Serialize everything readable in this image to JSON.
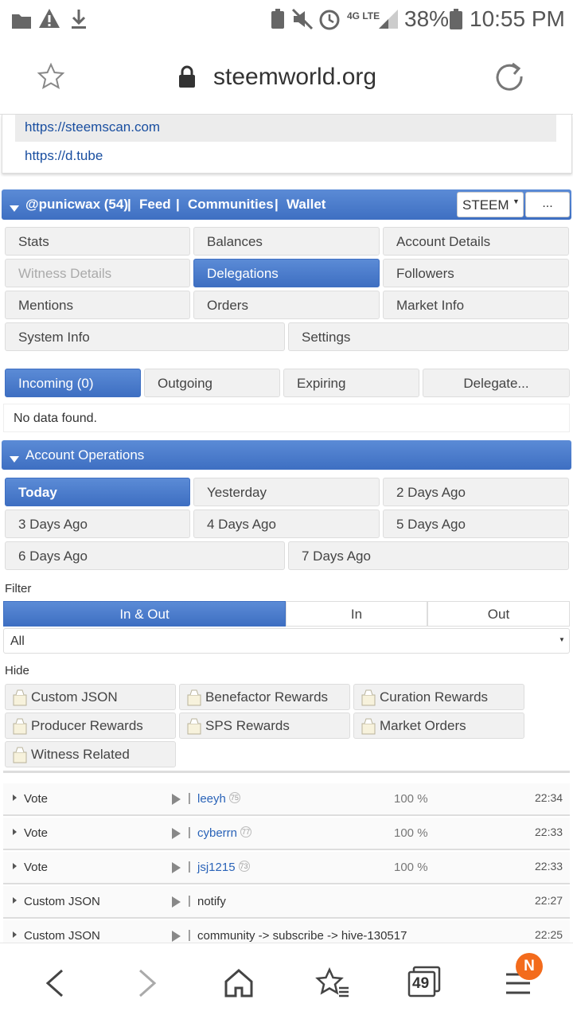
{
  "status_bar": {
    "battery": "38%",
    "time": "10:55 PM",
    "network": "4G LTE"
  },
  "browser": {
    "url": "steemworld.org",
    "tab_count": "49",
    "menu_badge": "N"
  },
  "links": [
    "https://steemscan.com",
    "https://d.tube"
  ],
  "account_bar": {
    "account": "@punicwax (54)",
    "sep": "|",
    "feed": "Feed",
    "communities": "Communities",
    "wallet": "Wallet",
    "currency": "STEEM",
    "more": "..."
  },
  "tabs": {
    "stats": "Stats",
    "balances": "Balances",
    "account_details": "Account Details",
    "witness_details": "Witness Details",
    "delegations": "Delegations",
    "followers": "Followers",
    "mentions": "Mentions",
    "orders": "Orders",
    "market_info": "Market Info",
    "system_info": "System Info",
    "settings": "Settings"
  },
  "delegation_tabs": {
    "incoming": "Incoming (0)",
    "outgoing": "Outgoing",
    "expiring": "Expiring",
    "delegate": "Delegate..."
  },
  "no_data": "No data found.",
  "account_operations": {
    "title": "Account Operations",
    "days": {
      "today": "Today",
      "yesterday": "Yesterday",
      "d2": "2 Days Ago",
      "d3": "3 Days Ago",
      "d4": "4 Days Ago",
      "d5": "5 Days Ago",
      "d6": "6 Days Ago",
      "d7": "7 Days Ago"
    },
    "filter_label": "Filter",
    "filter": {
      "in_out": "In & Out",
      "in": "In",
      "out": "Out"
    },
    "select_value": "All",
    "hide_label": "Hide",
    "hide": {
      "custom_json": "Custom JSON",
      "benefactor": "Benefactor Rewards",
      "curation": "Curation Rewards",
      "producer": "Producer Rewards",
      "sps": "SPS Rewards",
      "market": "Market Orders",
      "witness": "Witness Related"
    },
    "rows": [
      {
        "type": "Vote",
        "who": "leeyh",
        "rep": "75",
        "pct": "100 %",
        "time": "22:34"
      },
      {
        "type": "Vote",
        "who": "cyberrn",
        "rep": "77",
        "pct": "100 %",
        "time": "22:33"
      },
      {
        "type": "Vote",
        "who": "jsj1215",
        "rep": "73",
        "pct": "100 %",
        "time": "22:33"
      },
      {
        "type": "Custom JSON",
        "who": "notify",
        "time": "22:27"
      },
      {
        "type": "Custom JSON",
        "who": "community -> subscribe -> hive-130517",
        "time": "22:25"
      }
    ]
  }
}
